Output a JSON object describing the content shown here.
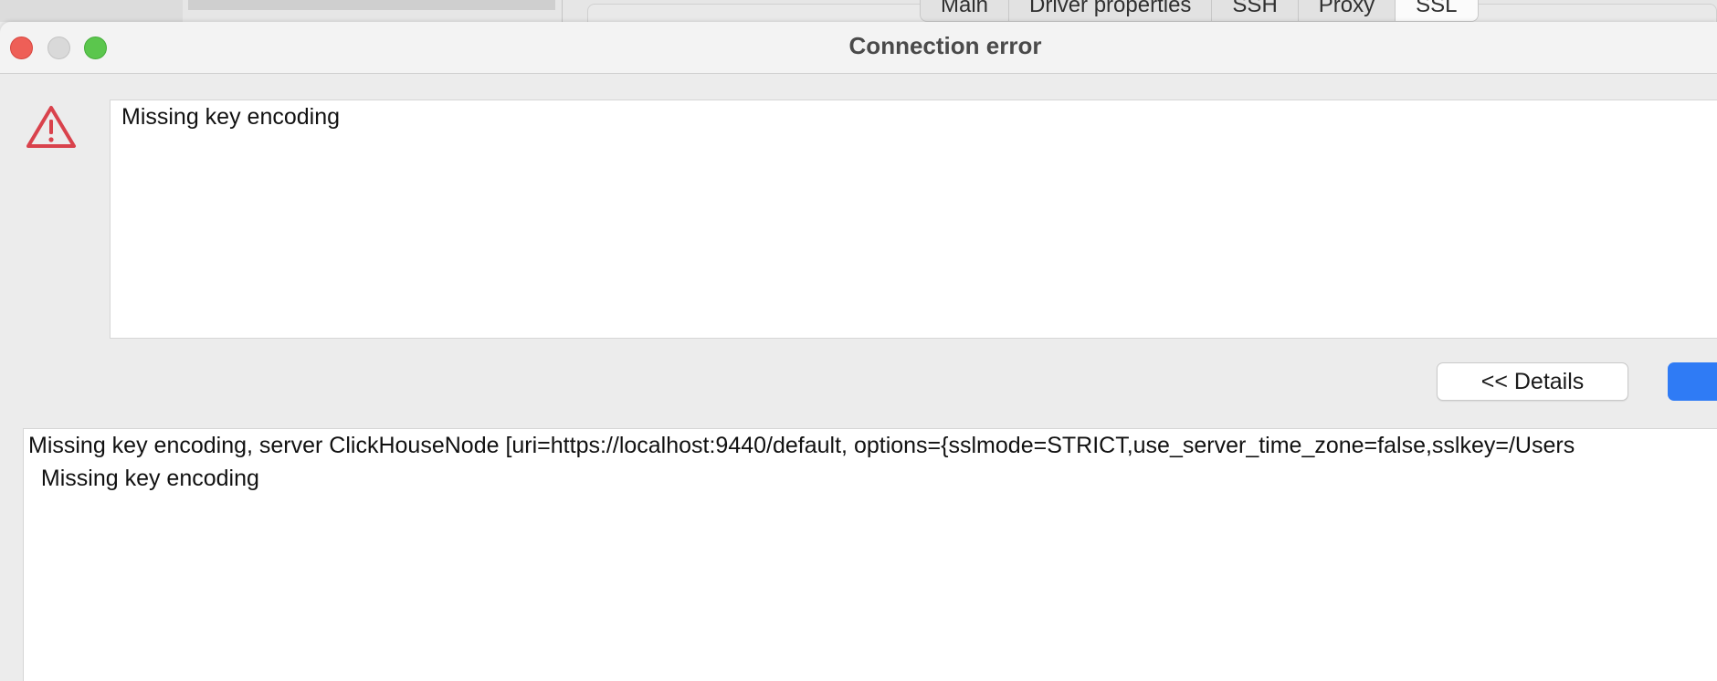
{
  "background_window": {
    "tabs": [
      {
        "label": "Main"
      },
      {
        "label": "Driver properties"
      },
      {
        "label": "SSH"
      },
      {
        "label": "Proxy"
      },
      {
        "label": "SSL",
        "selected": true
      }
    ]
  },
  "dialog": {
    "title": "Connection error",
    "message": "Missing key encoding",
    "details_button_label": "<< Details",
    "details_lines": [
      "Missing key encoding, server ClickHouseNode [uri=https://localhost:9440/default, options={sslmode=STRICT,use_server_time_zone=false,sslkey=/Users",
      "  Missing key encoding"
    ]
  },
  "colors": {
    "accent": "#2f7bf5",
    "warning": "#d9424c",
    "close": "#ee5f57",
    "maximize": "#5bc64d"
  },
  "icons": {
    "warning": "warning-triangle-icon"
  }
}
